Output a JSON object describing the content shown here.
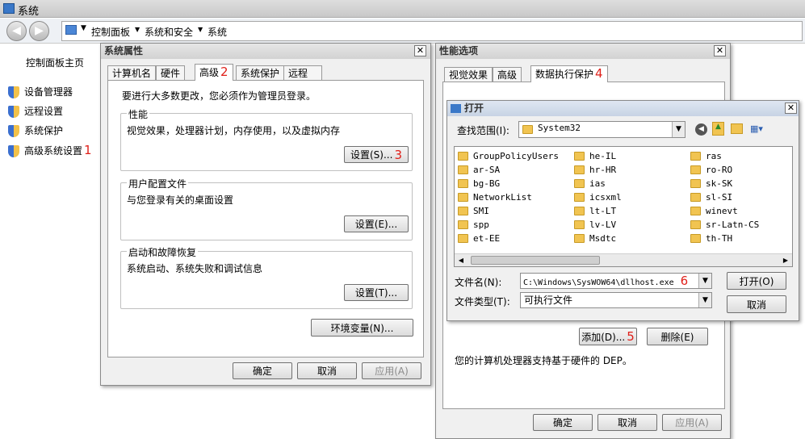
{
  "window": {
    "title": "系统"
  },
  "address": {
    "crumbs": [
      "控制面板",
      "系统和安全",
      "系统"
    ]
  },
  "sidebar": {
    "home": "控制面板主页",
    "items": [
      {
        "label": "设备管理器",
        "num": ""
      },
      {
        "label": "远程设置",
        "num": ""
      },
      {
        "label": "系统保护",
        "num": ""
      },
      {
        "label": "高级系统设置",
        "num": "1"
      }
    ]
  },
  "sysprops": {
    "title": "系统属性",
    "tabs": [
      "计算机名",
      "硬件",
      "高级",
      "系统保护",
      "远程"
    ],
    "adv_num": "2",
    "admin_note": "要进行大多数更改，您必须作为管理员登录。",
    "perf": {
      "title": "性能",
      "desc": "视觉效果，处理器计划，内存使用，以及虚拟内存",
      "btn": "设置(S)...",
      "num": "3"
    },
    "profile": {
      "title": "用户配置文件",
      "desc": "与您登录有关的桌面设置",
      "btn": "设置(E)..."
    },
    "startup": {
      "title": "启动和故障恢复",
      "desc": "系统启动、系统失败和调试信息",
      "btn": "设置(T)..."
    },
    "env_btn": "环境变量(N)...",
    "ok": "确定",
    "cancel": "取消",
    "apply": "应用(A)"
  },
  "perfopts": {
    "title": "性能选项",
    "tabs": [
      "视觉效果",
      "高级",
      "数据执行保护"
    ],
    "dep_num": "4",
    "add_btn": "添加(D)...",
    "add_num": "5",
    "remove_btn": "删除(E)",
    "dep_support": "您的计算机处理器支持基于硬件的 DEP。",
    "ok": "确定",
    "cancel": "取消",
    "apply": "应用(A)"
  },
  "opendlg": {
    "title": "打开",
    "lookin_label": "查找范围(I):",
    "lookin_value": "System32",
    "files": [
      "GroupPolicyUsers",
      "he-IL",
      "ras",
      "ar-SA",
      "hr-HR",
      "ro-RO",
      "bg-BG",
      "ias",
      "sk-SK",
      "NetworkList",
      "icsxml",
      "sl-SI",
      "SMI",
      "lt-LT",
      "winevt",
      "spp",
      "lv-LV",
      "sr-Latn-CS",
      "et-EE",
      "Msdtc",
      "th-TH"
    ],
    "filename_label": "文件名(N):",
    "filename_value": "C:\\Windows\\SysWOW64\\dllhost.exe",
    "filename_num": "6",
    "filetype_label": "文件类型(T):",
    "filetype_value": "可执行文件",
    "open_btn": "打开(O)",
    "cancel_btn": "取消"
  }
}
